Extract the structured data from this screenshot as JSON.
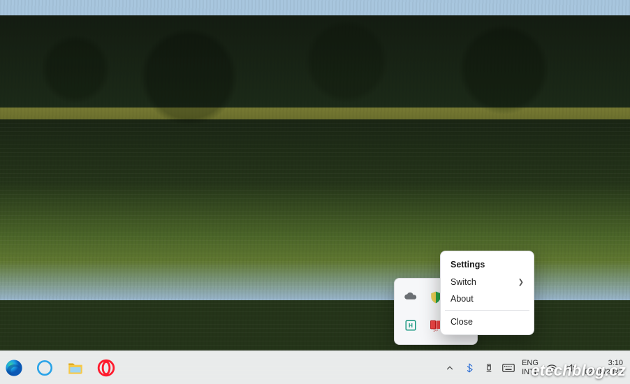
{
  "context_menu": {
    "header": "Settings",
    "items": [
      {
        "label": "Switch",
        "has_submenu": true
      },
      {
        "label": "About",
        "has_submenu": false
      }
    ],
    "footer_item": "Close"
  },
  "tray_overflow": {
    "icons": [
      "onedrive-icon",
      "windows-security-icon",
      "app-blue-icon",
      "hwinfo-icon",
      "dictionary-icon",
      "blank"
    ]
  },
  "taskbar": {
    "pinned": [
      "edge",
      "cortana",
      "file-explorer",
      "opera"
    ],
    "tray_icons": [
      "chevron-up-icon",
      "bluetooth-icon",
      "usb-eject-icon",
      "touch-keyboard-icon"
    ],
    "language": {
      "line1": "ENG",
      "line2": "INTL"
    },
    "status_icons": [
      "wifi-icon",
      "volume-icon"
    ],
    "clock": {
      "time": "3:10",
      "date": "02/08/2023"
    }
  },
  "watermark": "etechblog.cz"
}
